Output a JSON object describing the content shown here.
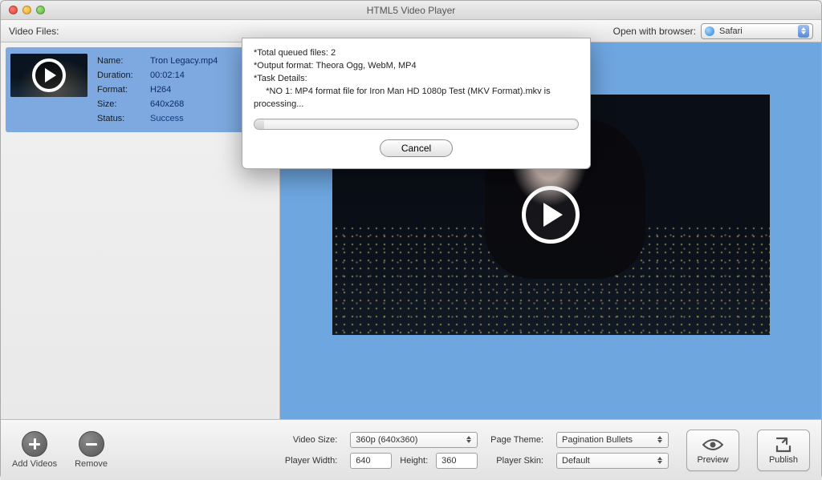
{
  "title": "HTML5 Video Player",
  "toolbar": {
    "video_files_label": "Video Files:",
    "open_with_label": "Open with browser:",
    "browser_selected": "Safari"
  },
  "file": {
    "labels": {
      "name": "Name:",
      "duration": "Duration:",
      "format": "Format:",
      "size": "Size:",
      "status": "Status:"
    },
    "name": "Tron Legacy.mp4",
    "duration": "00:02:14",
    "format": "H264",
    "size": "640x268",
    "status": "Success"
  },
  "modal": {
    "line1": "*Total queued files: 2",
    "line2": "*Output format: Theora Ogg, WebM, MP4",
    "line3": "*Task Details:",
    "line4": "     *NO 1: MP4 format file for Iron Man HD 1080p Test (MKV Format).mkv is processing...",
    "cancel": "Cancel"
  },
  "bottom": {
    "add_videos": "Add Videos",
    "remove": "Remove",
    "video_size_label": "Video Size:",
    "video_size_value": "360p (640x360)",
    "player_width_label": "Player Width:",
    "player_width_value": "640",
    "height_label": "Height:",
    "height_value": "360",
    "page_theme_label": "Page Theme:",
    "page_theme_value": "Pagination Bullets",
    "player_skin_label": "Player Skin:",
    "player_skin_value": "Default",
    "preview": "Preview",
    "publish": "Publish"
  }
}
